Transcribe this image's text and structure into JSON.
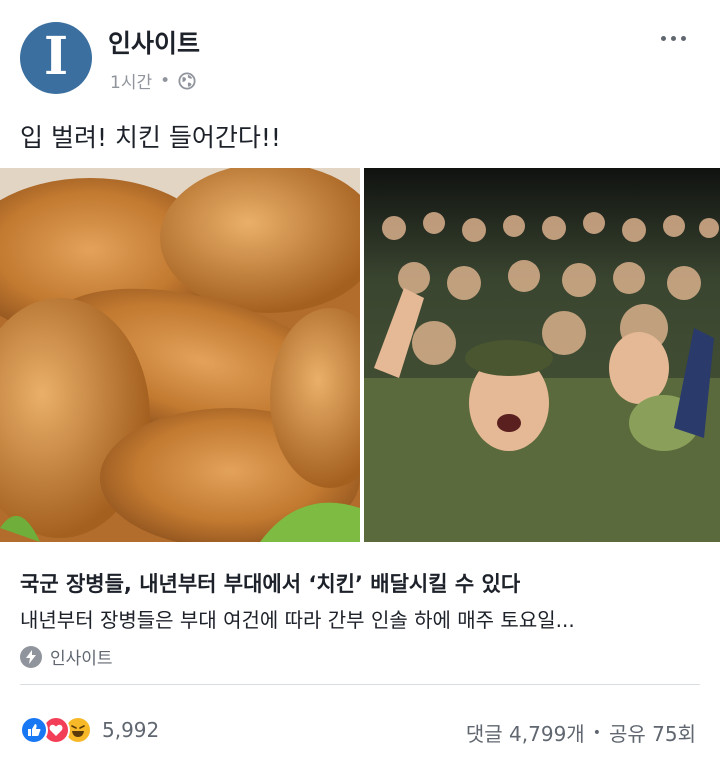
{
  "post": {
    "page_name": "인사이트",
    "avatar_letter": "I",
    "time": "1시간",
    "privacy_icon": "globe-icon",
    "text": "입 벌려! 치킨 들어간다!!"
  },
  "images": [
    {
      "name": "fried-chicken-photo"
    },
    {
      "name": "soldiers-cheering-photo"
    }
  ],
  "link": {
    "title": "국군 장병들, 내년부터 부대에서 ‘치킨’ 배달시킬 수 있다",
    "description": "내년부터 장병들은 부대 여건에 따라 간부 인솔 하에 매주 토요일...",
    "source": "인사이트"
  },
  "footer": {
    "reaction_count": "5,992",
    "comments": "댓글 4,799개",
    "separator": "•",
    "shares": "공유 75회"
  },
  "colors": {
    "avatar": "#3b6fa0",
    "like": "#1877f2",
    "love": "#f33e58",
    "haha": "#f7b928"
  }
}
